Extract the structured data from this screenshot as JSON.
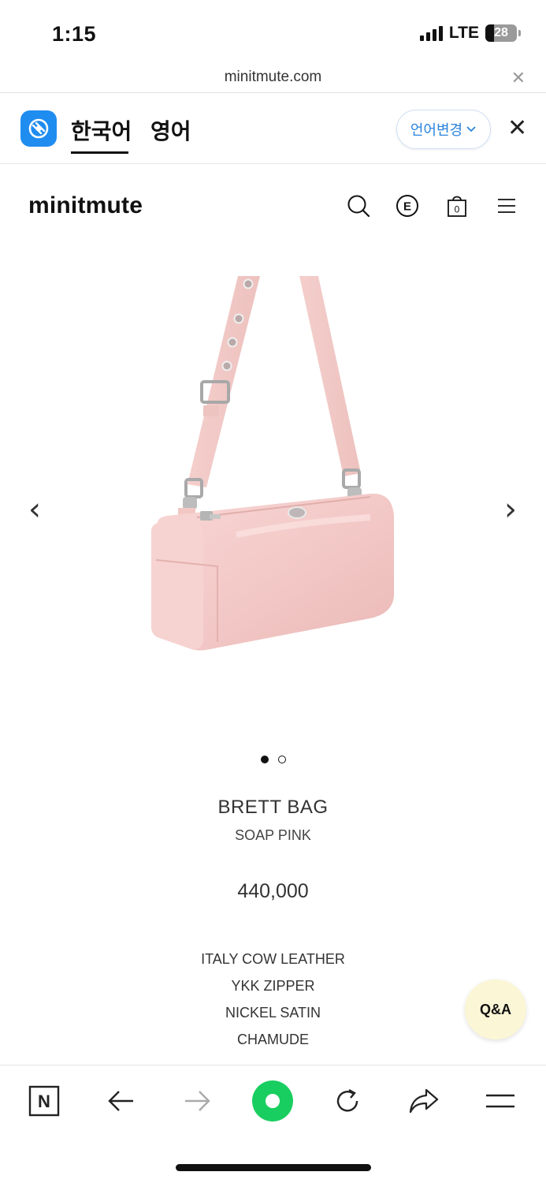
{
  "status_bar": {
    "time": "1:15",
    "network": "LTE",
    "battery": "28"
  },
  "url_bar": {
    "domain": "minitmute.com",
    "close_icon": "close-icon"
  },
  "translate_bar": {
    "app_icon": "papago-icon",
    "lang_source": "한국어",
    "lang_target": "영어",
    "change_language_label": "언어변경",
    "accent_color": "#2c84dc"
  },
  "header": {
    "logo": "minitmute",
    "icons": [
      "search-icon",
      "currency-icon",
      "cart-icon",
      "menu-icon"
    ],
    "cart_count": "0",
    "currency_letter": "E"
  },
  "gallery": {
    "prev_glyph": "‹",
    "next_glyph": "›",
    "slide_count": 2,
    "active_slide": 1
  },
  "product": {
    "name": "BRETT BAG",
    "color": "SOAP PINK",
    "price": "440,000",
    "specs": [
      "ITALY COW LEATHER",
      "YKK ZIPPER",
      "NICKEL SATIN",
      "CHAMUDE"
    ]
  },
  "qa_button": {
    "label": "Q&A",
    "background": "#fbf6d6"
  },
  "toolbar": {
    "items": [
      "naver-icon",
      "back-arrow-icon",
      "forward-arrow-icon",
      "green-home-icon",
      "refresh-icon",
      "share-icon",
      "menu-icon"
    ],
    "naver_letter": "N",
    "green": "#19ce60"
  }
}
